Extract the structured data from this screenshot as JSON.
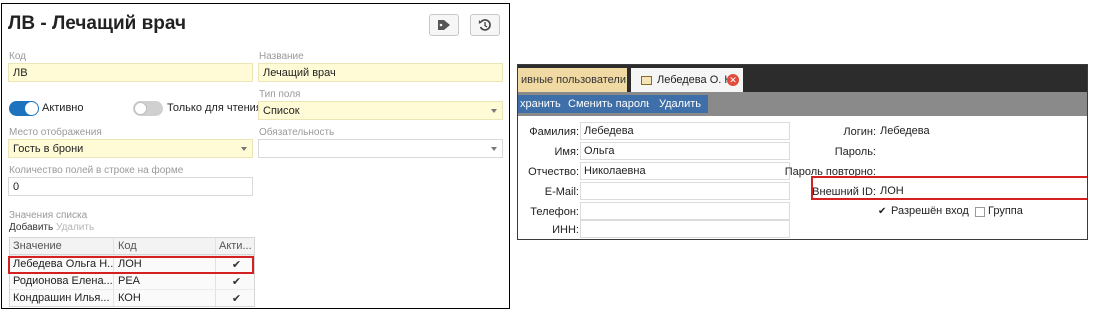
{
  "left": {
    "title": "ЛВ - Лечащий врач",
    "code_label": "Код",
    "code_value": "ЛВ",
    "name_label": "Название",
    "name_value": "Лечащий врач",
    "active_label": "Активно",
    "readonly_label": "Только для чтения",
    "field_type_label": "Тип поля",
    "field_type_value": "Список",
    "display_place_label": "Место отображения",
    "display_place_value": "Гость в брони",
    "required_label": "Обязательность",
    "required_value": "",
    "fields_per_row_label": "Количество полей в строке на форме",
    "fields_per_row_value": "0",
    "list_values_label": "Значения списка",
    "add_link": "Добавить",
    "delete_link": "Удалить",
    "table": {
      "headers": [
        "Значение",
        "Код",
        "Акти..."
      ],
      "rows": [
        {
          "value": "Лебедева Ольга Н...",
          "code": "ЛОН",
          "active": "✔"
        },
        {
          "value": "Родионова Елена...",
          "code": "РЕА",
          "active": "✔"
        },
        {
          "value": "Кондрашин Илья...",
          "code": "КОН",
          "active": "✔"
        }
      ]
    },
    "colors": {
      "toggle_on": "#1e73be",
      "toggle_off": "#d0d0d0",
      "highlight": "#d42020"
    }
  },
  "right": {
    "tab_inactive": "ивные пользователи",
    "tab_active": "Лебедева О. Н.",
    "buttons": {
      "save": "хранить",
      "change_password": "Сменить пароль",
      "delete": "Удалить"
    },
    "surname_label": "Фамилия:",
    "surname_value": "Лебедева",
    "name_label": "Имя:",
    "name_value": "Ольга",
    "patronymic_label": "Отчество:",
    "patronymic_value": "Николаевна",
    "email_label": "E-Mail:",
    "email_value": "",
    "phone_label": "Телефон:",
    "phone_value": "",
    "inn_label": "ИНН:",
    "inn_value": "",
    "login_label": "Логин:",
    "login_value": "Лебедева",
    "password_label": "Пароль:",
    "password_repeat_label": "Пароль повторно:",
    "external_id_label": "Внешний ID:",
    "external_id_value": "ЛОН",
    "login_allowed_label": "Разрешён вход",
    "group_label": "Группа",
    "colors": {
      "tabbar": "#2c2c2c",
      "toolbar": "#8a8a8a",
      "button": "#3f6fa8"
    }
  }
}
